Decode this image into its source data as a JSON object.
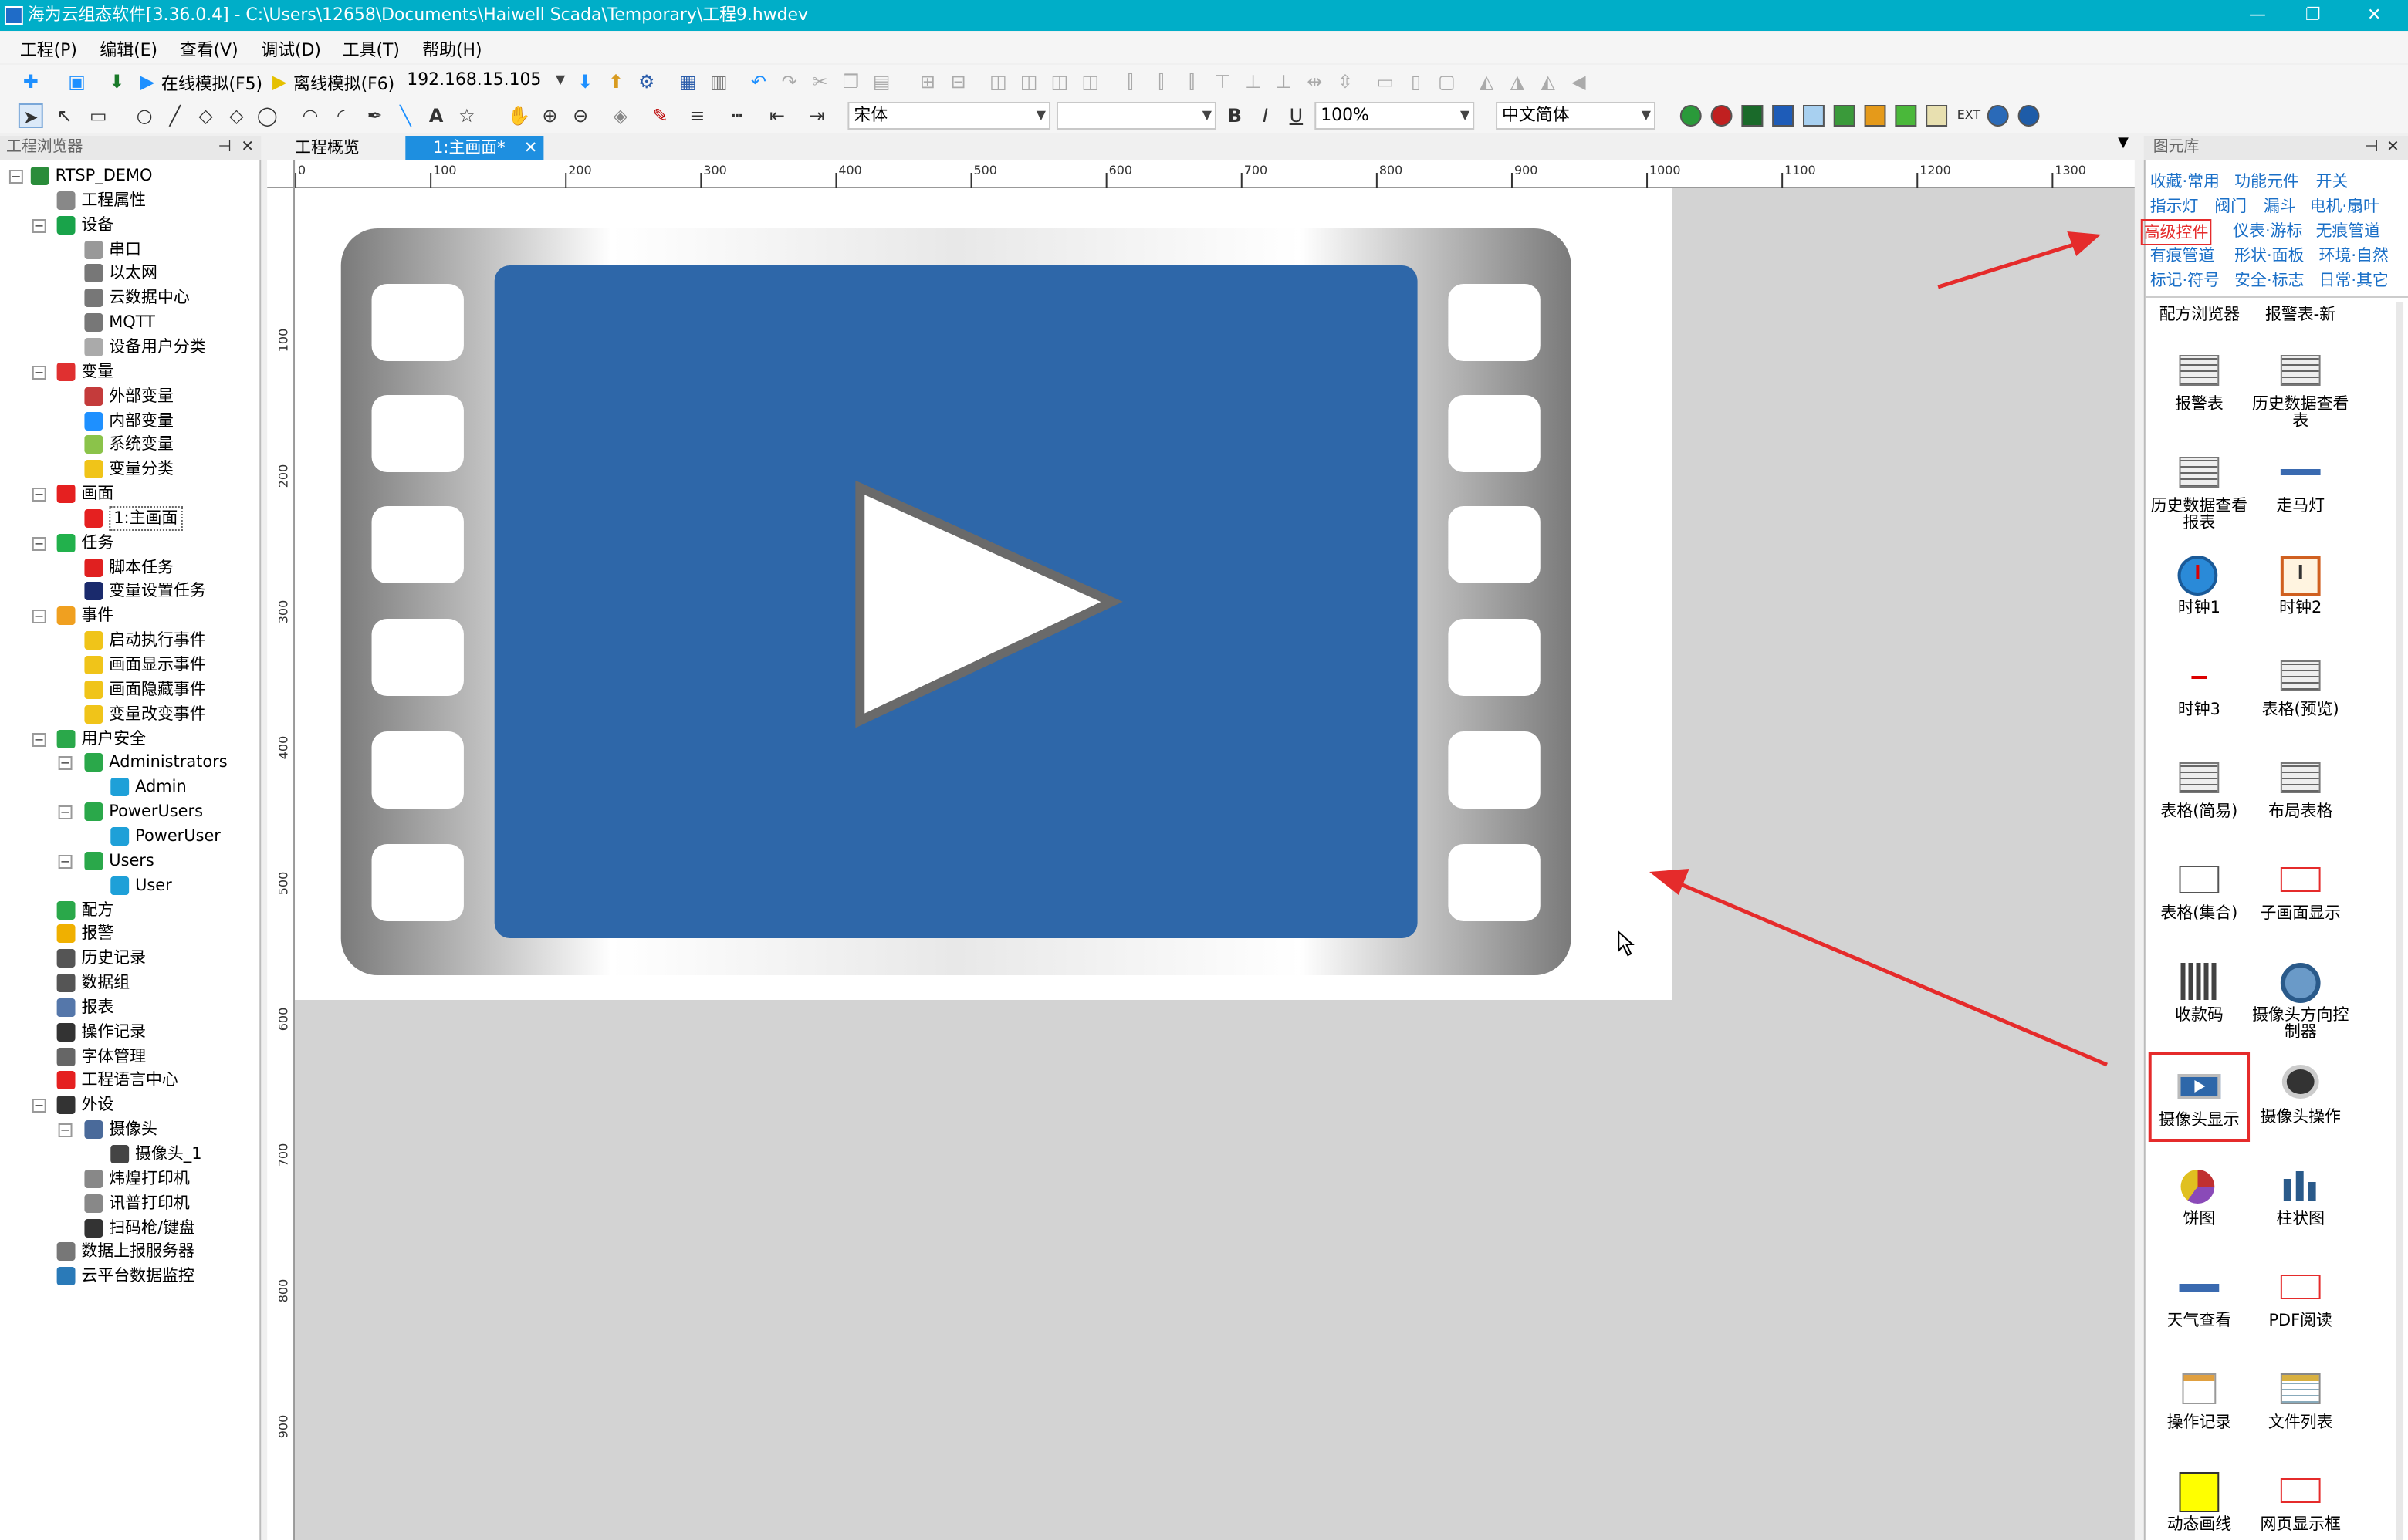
{
  "window": {
    "title": "海为云组态软件[3.36.0.4] - C:\\Users\\12658\\Documents\\Haiwell Scada\\Temporary\\工程9.hwdev",
    "minimize": "—",
    "maximize": "❐",
    "close": "✕"
  },
  "menu": [
    "工程(P)",
    "编辑(E)",
    "查看(V)",
    "调试(D)",
    "工具(T)",
    "帮助(H)"
  ],
  "toolbar": {
    "online_sim": "在线模拟(F5)",
    "offline_sim": "离线模拟(F6)",
    "ip": "192.168.15.105",
    "font_name": "宋体",
    "font_size": "",
    "bold": "B",
    "italic": "I",
    "underline": "U",
    "zoom": "100%",
    "language": "中文简体",
    "text_tool": "A"
  },
  "left_panel": {
    "title": "工程浏览器",
    "tree": [
      {
        "label": "RTSP_DEMO",
        "level": 0,
        "toggle": "−",
        "icon": "project-icon",
        "color": "#2a8c3a"
      },
      {
        "label": "工程属性",
        "level": 1,
        "toggle": "",
        "icon": "properties-icon",
        "color": "#888888"
      },
      {
        "label": "设备",
        "level": 1,
        "toggle": "−",
        "icon": "device-icon",
        "color": "#19a34a"
      },
      {
        "label": "串口",
        "level": 2,
        "toggle": "",
        "icon": "serial-port-icon",
        "color": "#999999"
      },
      {
        "label": "以太网",
        "level": 2,
        "toggle": "",
        "icon": "ethernet-icon",
        "color": "#777777"
      },
      {
        "label": "云数据中心",
        "level": 2,
        "toggle": "",
        "icon": "cloud-data-icon",
        "color": "#777777"
      },
      {
        "label": "MQTT",
        "level": 2,
        "toggle": "",
        "icon": "mqtt-icon",
        "color": "#777777"
      },
      {
        "label": "设备用户分类",
        "level": 2,
        "toggle": "",
        "icon": "device-user-icon",
        "color": "#aaaaaa"
      },
      {
        "label": "变量",
        "level": 1,
        "toggle": "−",
        "icon": "variable-icon",
        "color": "#e03030"
      },
      {
        "label": "外部变量",
        "level": 2,
        "toggle": "",
        "icon": "external-variable-icon",
        "color": "#c43b3b"
      },
      {
        "label": "内部变量",
        "level": 2,
        "toggle": "",
        "icon": "internal-variable-icon",
        "color": "#1e90ff"
      },
      {
        "label": "系统变量",
        "level": 2,
        "toggle": "",
        "icon": "system-variable-icon",
        "color": "#8bc34a"
      },
      {
        "label": "变量分类",
        "level": 2,
        "toggle": "",
        "icon": "folder-icon",
        "color": "#f0c419"
      },
      {
        "label": "画面",
        "level": 1,
        "toggle": "−",
        "icon": "screen-icon",
        "color": "#e52020"
      },
      {
        "label": "1:主画面",
        "level": 2,
        "toggle": "",
        "icon": "main-screen-icon",
        "color": "#e52020",
        "selected": true
      },
      {
        "label": "任务",
        "level": 1,
        "toggle": "−",
        "icon": "task-icon",
        "color": "#22b14c"
      },
      {
        "label": "脚本任务",
        "level": 2,
        "toggle": "",
        "icon": "script-task-icon",
        "color": "#e02020"
      },
      {
        "label": "变量设置任务",
        "level": 2,
        "toggle": "",
        "icon": "variable-task-icon",
        "color": "#1a2a6c"
      },
      {
        "label": "事件",
        "level": 1,
        "toggle": "−",
        "icon": "event-icon",
        "color": "#f0a020"
      },
      {
        "label": "启动执行事件",
        "level": 2,
        "toggle": "",
        "icon": "lightning-icon",
        "color": "#f0c419"
      },
      {
        "label": "画面显示事件",
        "level": 2,
        "toggle": "",
        "icon": "lightning-icon",
        "color": "#f0c419"
      },
      {
        "label": "画面隐藏事件",
        "level": 2,
        "toggle": "",
        "icon": "lightning-icon",
        "color": "#f0c419"
      },
      {
        "label": "变量改变事件",
        "level": 2,
        "toggle": "",
        "icon": "lightning-icon",
        "color": "#f0c419"
      },
      {
        "label": "用户安全",
        "level": 1,
        "toggle": "−",
        "icon": "user-security-icon",
        "color": "#2aa84a"
      },
      {
        "label": "Administrators",
        "level": 2,
        "toggle": "−",
        "icon": "user-group-icon",
        "color": "#2aa84a"
      },
      {
        "label": "Admin",
        "level": 3,
        "toggle": "",
        "icon": "user-icon",
        "color": "#1ea0d8"
      },
      {
        "label": "PowerUsers",
        "level": 2,
        "toggle": "−",
        "icon": "user-group-icon",
        "color": "#2aa84a"
      },
      {
        "label": "PowerUser",
        "level": 3,
        "toggle": "",
        "icon": "user-icon",
        "color": "#1ea0d8"
      },
      {
        "label": "Users",
        "level": 2,
        "toggle": "−",
        "icon": "user-group-icon",
        "color": "#2aa84a"
      },
      {
        "label": "User",
        "level": 3,
        "toggle": "",
        "icon": "user-icon",
        "color": "#1ea0d8"
      },
      {
        "label": "配方",
        "level": 1,
        "toggle": "",
        "icon": "recipe-icon",
        "color": "#2aa84a"
      },
      {
        "label": "报警",
        "level": 1,
        "toggle": "",
        "icon": "alarm-bell-icon",
        "color": "#f0b000"
      },
      {
        "label": "历史记录",
        "level": 1,
        "toggle": "",
        "icon": "history-icon",
        "color": "#555555"
      },
      {
        "label": "数据组",
        "level": 1,
        "toggle": "",
        "icon": "data-group-icon",
        "color": "#555555"
      },
      {
        "label": "报表",
        "level": 1,
        "toggle": "",
        "icon": "report-icon",
        "color": "#5577aa"
      },
      {
        "label": "操作记录",
        "level": 1,
        "toggle": "",
        "icon": "operation-log-icon",
        "color": "#333333"
      },
      {
        "label": "字体管理",
        "level": 1,
        "toggle": "",
        "icon": "font-manager-icon",
        "color": "#666666"
      },
      {
        "label": "工程语言中心",
        "level": 1,
        "toggle": "",
        "icon": "language-icon",
        "color": "#e52020"
      },
      {
        "label": "外设",
        "level": 1,
        "toggle": "−",
        "icon": "peripheral-icon",
        "color": "#333333"
      },
      {
        "label": "摄像头",
        "level": 2,
        "toggle": "−",
        "icon": "camera-icon",
        "color": "#4a6a9a"
      },
      {
        "label": "摄像头_1",
        "level": 3,
        "toggle": "",
        "icon": "webcam-icon",
        "color": "#444444"
      },
      {
        "label": "炜煌打印机",
        "level": 2,
        "toggle": "",
        "icon": "printer-icon",
        "color": "#888888"
      },
      {
        "label": "讯普打印机",
        "level": 2,
        "toggle": "",
        "icon": "printer-icon",
        "color": "#888888"
      },
      {
        "label": "扫码枪/键盘",
        "level": 2,
        "toggle": "",
        "icon": "scanner-icon",
        "color": "#333333"
      },
      {
        "label": "数据上报服务器",
        "level": 1,
        "toggle": "",
        "icon": "server-icon",
        "color": "#777777"
      },
      {
        "label": "云平台数据监控",
        "level": 1,
        "toggle": "",
        "icon": "cloud-monitor-icon",
        "color": "#2a7ab8"
      }
    ]
  },
  "doc_tabs": [
    {
      "label": "工程概览",
      "active": false
    },
    {
      "label": "1:主画面*",
      "active": true,
      "close": "✕"
    }
  ],
  "ruler": {
    "top_labels": [
      "0",
      "100",
      "200",
      "300",
      "400",
      "500",
      "600",
      "700",
      "800",
      "900",
      "1000",
      "1100",
      "1200",
      "1300"
    ],
    "left_labels": [
      "100",
      "200",
      "300",
      "400",
      "500",
      "600",
      "700",
      "800",
      "900"
    ]
  },
  "canvas": {
    "player_color": "#2e67a9",
    "frame_colors": [
      "#7a7a7a",
      "#ffffff"
    ],
    "annotation_color": "#e52b2b"
  },
  "right_panel": {
    "title": "图元库",
    "categories": [
      [
        "收藏·常用",
        "功能元件",
        "开关"
      ],
      [
        "指示灯",
        "阀门",
        "漏斗",
        "电机·扇叶"
      ],
      [
        "高级控件",
        "仪表·游标",
        "无痕管道"
      ],
      [
        "有痕管道",
        "形状·面板",
        "环境·自然"
      ],
      [
        "标记·符号",
        "安全·标志",
        "日常·其它"
      ]
    ],
    "selected_category": "高级控件",
    "top_items": [
      "配方浏览器",
      "报警表-新"
    ],
    "components": [
      {
        "label": "报警表",
        "icon": "alarm-table-icon"
      },
      {
        "label": "历史数据查看表",
        "icon": "history-table-icon"
      },
      {
        "label": "历史数据查看报表",
        "icon": "history-report-icon"
      },
      {
        "label": "走马灯",
        "icon": "marquee-icon"
      },
      {
        "label": "时钟1",
        "icon": "clock-icon"
      },
      {
        "label": "时钟2",
        "icon": "clock-alt-icon"
      },
      {
        "label": "时钟3",
        "icon": "clock-digital-icon"
      },
      {
        "label": "表格(预览)",
        "icon": "table-preview-icon"
      },
      {
        "label": "表格(简易)",
        "icon": "table-simple-icon"
      },
      {
        "label": "布局表格",
        "icon": "layout-table-icon"
      },
      {
        "label": "表格(集合)",
        "icon": "table-set-icon"
      },
      {
        "label": "子画面显示",
        "icon": "subscreen-icon"
      },
      {
        "label": "收款码",
        "icon": "qr-code-icon"
      },
      {
        "label": "摄像头方向控制器",
        "icon": "camera-direction-icon"
      },
      {
        "label": "摄像头显示",
        "icon": "camera-display-icon",
        "highlighted": true
      },
      {
        "label": "摄像头操作",
        "icon": "camera-operate-icon"
      },
      {
        "label": "饼图",
        "icon": "pie-chart-icon"
      },
      {
        "label": "柱状图",
        "icon": "bar-chart-icon"
      },
      {
        "label": "天气查看",
        "icon": "weather-icon"
      },
      {
        "label": "PDF阅读",
        "icon": "pdf-reader-icon"
      },
      {
        "label": "操作记录",
        "icon": "operation-record-icon"
      },
      {
        "label": "文件列表",
        "icon": "file-list-icon"
      },
      {
        "label": "动态画线",
        "icon": "dynamic-line-icon"
      },
      {
        "label": "网页显示框",
        "icon": "webpage-frame-icon"
      }
    ]
  }
}
